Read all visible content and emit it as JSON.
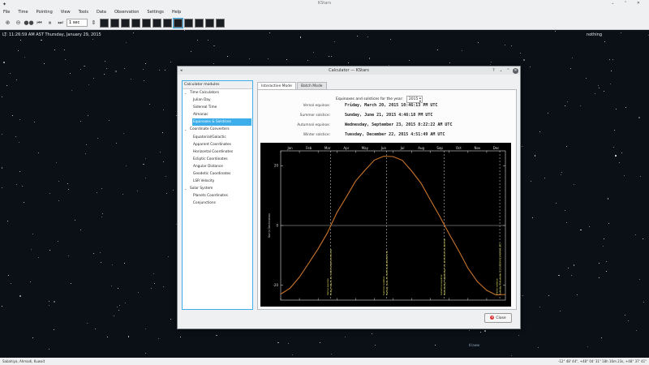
{
  "app": {
    "title": "KStars",
    "window_controls": "⌄ ⌃ ✕"
  },
  "menu": [
    "File",
    "Time",
    "Pointing",
    "View",
    "Tools",
    "Data",
    "Observation",
    "Settings",
    "Help"
  ],
  "toolbar": {
    "time_step": "1 sec"
  },
  "sky": {
    "info_text": "LT: 11:26:59 AM AST  Thursday, January 29, 2015",
    "focus_object": "nothing",
    "constellation_label": "Kraww"
  },
  "status": {
    "location": "Sabahiya, Ahmadi, Kuwait",
    "coords": "-12° 48' 44\", +48° 04' 31\"  18h 16m 23s, +48° 37' 41\""
  },
  "dialog": {
    "title": "Calculator — KStars",
    "tree_header": "Calculator modules",
    "tree": [
      {
        "label": "Time Calculators",
        "level": 0,
        "expanded": true
      },
      {
        "label": "Julian Day",
        "level": 1
      },
      {
        "label": "Sidereal Time",
        "level": 1
      },
      {
        "label": "Almanac",
        "level": 1
      },
      {
        "label": "Equinoxes & Solstices",
        "level": 1,
        "selected": true
      },
      {
        "label": "Coordinate Converters",
        "level": 0,
        "expanded": true
      },
      {
        "label": "Equatorial/Galactic",
        "level": 1
      },
      {
        "label": "Apparent Coordinates",
        "level": 1
      },
      {
        "label": "Horizontal Coordinates",
        "level": 1
      },
      {
        "label": "Ecliptic Coordinates",
        "level": 1
      },
      {
        "label": "Angular Distance",
        "level": 1
      },
      {
        "label": "Geodetic Coordinates",
        "level": 1
      },
      {
        "label": "LSR Velocity",
        "level": 1
      },
      {
        "label": "Solar System",
        "level": 0,
        "expanded": true
      },
      {
        "label": "Planets Coordinates",
        "level": 1
      },
      {
        "label": "Conjunctions",
        "level": 1
      }
    ],
    "tabs": [
      "Interactive Mode",
      "Batch Mode"
    ],
    "year_label": "Equinoxes and solstices for the year:",
    "year_value": "2015",
    "events": [
      {
        "label": "Vernal equinox:",
        "value": "Friday, March 20, 2015 10:46:13 PM UTC"
      },
      {
        "label": "Summer solstice:",
        "value": "Sunday, June 21, 2015 4:46:18 PM UTC"
      },
      {
        "label": "Autumnal equinox:",
        "value": "Wednesday, September 23, 2015 8:22:22 AM UTC"
      },
      {
        "label": "Winter solstice:",
        "value": "Tuesday, December 22, 2015 4:51:49 AM UTC"
      }
    ],
    "close_label": "Close"
  },
  "chart_data": {
    "type": "line",
    "months": [
      "Jan",
      "Feb",
      "Mar",
      "Apr",
      "May",
      "Jun",
      "Jul",
      "Aug",
      "Sep",
      "Oct",
      "Nov",
      "Dec"
    ],
    "ylabel": "Sun's Declination",
    "ylim": [
      -25,
      25
    ],
    "yticks": [
      -20,
      0,
      20
    ],
    "x": [
      0,
      0.5,
      1,
      1.5,
      2,
      2.5,
      3,
      3.5,
      4,
      4.5,
      5,
      5.5,
      6,
      6.5,
      7,
      7.5,
      8,
      8.5,
      9,
      9.5,
      10,
      10.5,
      11,
      11.5,
      12
    ],
    "values": [
      -23.0,
      -21.0,
      -17.3,
      -12.6,
      -7.8,
      -2.4,
      4.3,
      9.5,
      14.9,
      18.5,
      21.9,
      23.2,
      23.1,
      21.8,
      18.2,
      14.1,
      8.5,
      3.0,
      -2.9,
      -8.4,
      -14.3,
      -18.8,
      -21.7,
      -23.3,
      -23.1
    ],
    "color": "#c8742a",
    "event_lines": [
      {
        "x": 2.66,
        "label": "Vernal equinox",
        "date": "Friday, March 20, 2015 10:46:13 PM UTC"
      },
      {
        "x": 5.66,
        "label": "Summer solstice",
        "date": "Sunday, June 21, 2015 4:46:18 PM UTC"
      },
      {
        "x": 8.73,
        "label": "Autumnal equinox",
        "date": "Wednesday, September 23, 2015 8:22:22 AM UTC"
      },
      {
        "x": 11.7,
        "label": "Winter solstice",
        "date": "Tuesday, December 22, 2015 4:51:49 AM UTC"
      }
    ]
  }
}
